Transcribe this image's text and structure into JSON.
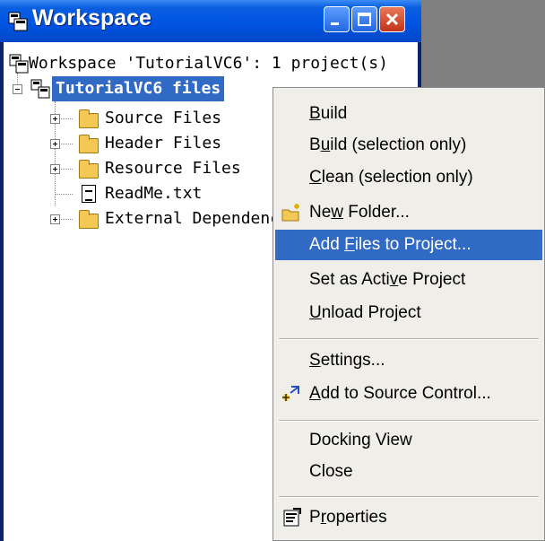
{
  "window": {
    "title": "Workspace"
  },
  "tree": {
    "root_label": "Workspace 'TutorialVC6': 1 project(s)",
    "project_label": "TutorialVC6 files",
    "items": [
      {
        "label": "Source Files"
      },
      {
        "label": "Header Files"
      },
      {
        "label": "Resource Files"
      },
      {
        "label": "ReadMe.txt"
      },
      {
        "label": "External Dependencies"
      }
    ]
  },
  "menu": {
    "build": {
      "pre": "",
      "u": "B",
      "post": "uild"
    },
    "build_sel": {
      "pre": "B",
      "u": "u",
      "post": "ild (selection only)"
    },
    "clean_sel": {
      "pre": "",
      "u": "C",
      "post": "lean (selection only)"
    },
    "new_folder": {
      "pre": "Ne",
      "u": "w",
      "post": " Folder..."
    },
    "add_files": {
      "pre": "Add ",
      "u": "F",
      "post": "iles to Project..."
    },
    "set_active": {
      "pre": "Set as Acti",
      "u": "v",
      "post": "e Project"
    },
    "unload": {
      "pre": "",
      "u": "U",
      "post": "nload Project"
    },
    "settings": {
      "pre": "",
      "u": "S",
      "post": "ettings..."
    },
    "add_source_control": {
      "pre": "",
      "u": "A",
      "post": "dd to Source Control..."
    },
    "docking_view": "Docking View",
    "close": "Close",
    "properties": {
      "pre": "P",
      "u": "r",
      "post": "operties"
    }
  },
  "colors": {
    "selection": "#316ac5",
    "menu_bg": "#f0eee8",
    "titlebar": "#0054e3",
    "folder": "#f3c855"
  }
}
